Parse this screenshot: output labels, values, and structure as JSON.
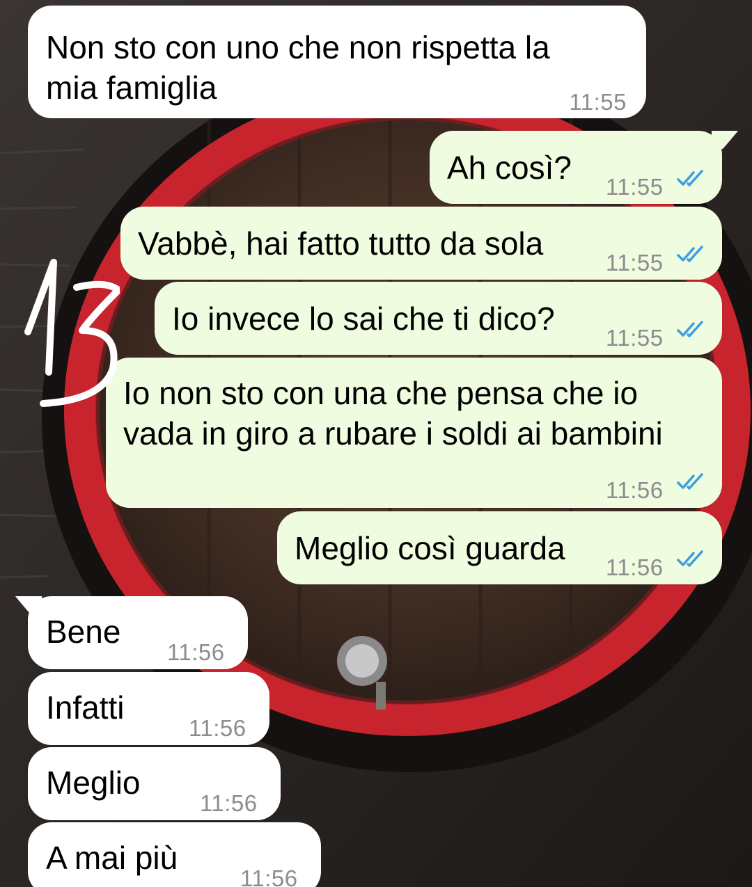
{
  "chat": {
    "colors": {
      "incoming_bubble": "#ffffff",
      "outgoing_bubble": "#effcdf",
      "timestamp": "#8c8c8c",
      "read_ticks": "#3a9fe0",
      "annotation": "#ffffff",
      "barrel_ring": "#c8242e"
    },
    "annotation_mark": "handwritten-13-icon",
    "messages": [
      {
        "id": "m1",
        "direction": "incoming",
        "line1": "Non sto con uno che non rispetta la",
        "line2": "mia famiglia",
        "time": "11:55"
      },
      {
        "id": "m2",
        "direction": "outgoing",
        "text": "Ah così?",
        "time": "11:55",
        "status": "read-double-check-icon"
      },
      {
        "id": "m3",
        "direction": "outgoing",
        "text": "Vabbè, hai fatto tutto da sola",
        "time": "11:55",
        "status": "read-double-check-icon"
      },
      {
        "id": "m4",
        "direction": "outgoing",
        "text": "Io invece lo sai che ti dico?",
        "time": "11:55",
        "status": "read-double-check-icon"
      },
      {
        "id": "m5",
        "direction": "outgoing",
        "line1": "Io non sto con una che pensa che io",
        "line2": "vada in giro a rubare i soldi ai bambini",
        "time": "11:56",
        "status": "read-double-check-icon"
      },
      {
        "id": "m6",
        "direction": "outgoing",
        "text": "Meglio così guarda",
        "time": "11:56",
        "status": "read-double-check-icon"
      },
      {
        "id": "m7",
        "direction": "incoming",
        "text": "Bene",
        "time": "11:56"
      },
      {
        "id": "m8",
        "direction": "incoming",
        "text": "Infatti",
        "time": "11:56"
      },
      {
        "id": "m9",
        "direction": "incoming",
        "text": "Meglio",
        "time": "11:56"
      },
      {
        "id": "m10",
        "direction": "incoming",
        "text": "A mai più",
        "time": "11:56"
      }
    ]
  }
}
